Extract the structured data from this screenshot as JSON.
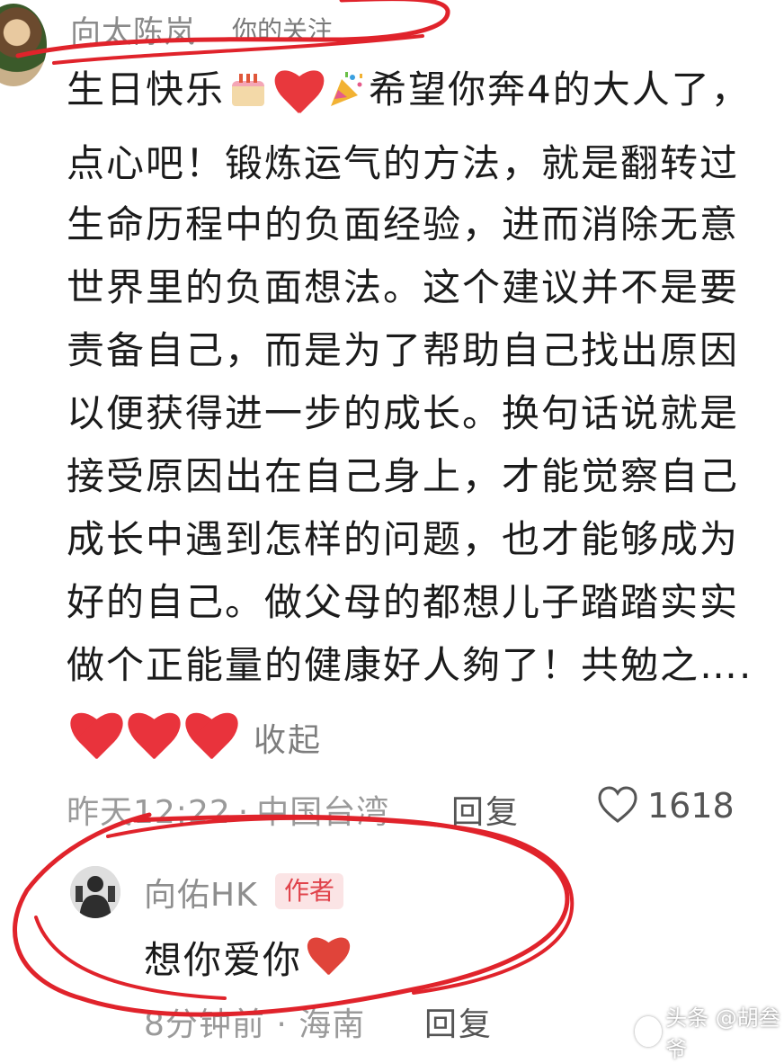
{
  "comment": {
    "username": "向太陈岚",
    "follow_tag": "你的关注",
    "lines": [
      {
        "before": "生日快乐",
        "after": "希望你奔4的大人了，"
      },
      {
        "text": "点心吧！锻炼运气的方法，就是翻转过"
      },
      {
        "text": "生命历程中的负面经验，进而消除无意"
      },
      {
        "text": "世界里的负面想法。这个建议并不是要"
      },
      {
        "text": "责备自己，而是为了帮助自己找出原因"
      },
      {
        "text": "以便获得进一步的成长。换句话说就是"
      },
      {
        "text": "接受原因出在自己身上，才能觉察自己"
      },
      {
        "text": "成长中遇到怎样的问题，也才能够成为"
      },
      {
        "text": "好的自己。做父母的都想儿子踏踏实实"
      },
      {
        "text": "做个正能量的健康好人夠了！共勉之…."
      }
    ],
    "collapse_label": "收起",
    "time": "昨天12:22",
    "separator": "·",
    "location": "中国台湾",
    "reply_label": "回复",
    "like_count": "1618",
    "icons": {
      "cake": "birthday-cake-emoji",
      "heart": "red-heart-emoji",
      "party": "party-popper-emoji",
      "like": "heart-outline-icon"
    }
  },
  "reply": {
    "username": "向佑HK",
    "badge": "作者",
    "text": "想你爱你",
    "time": "8分钟前",
    "separator": "·",
    "location": "海南",
    "reply_label": "回复"
  },
  "watermark": "头条 @胡叁爷",
  "colors": {
    "annotation_red": "#e0232b",
    "heart_red": "#e9333c",
    "badge_bg": "#fbe4e5",
    "badge_text": "#e0434b",
    "muted_text": "#9a9a9a"
  }
}
